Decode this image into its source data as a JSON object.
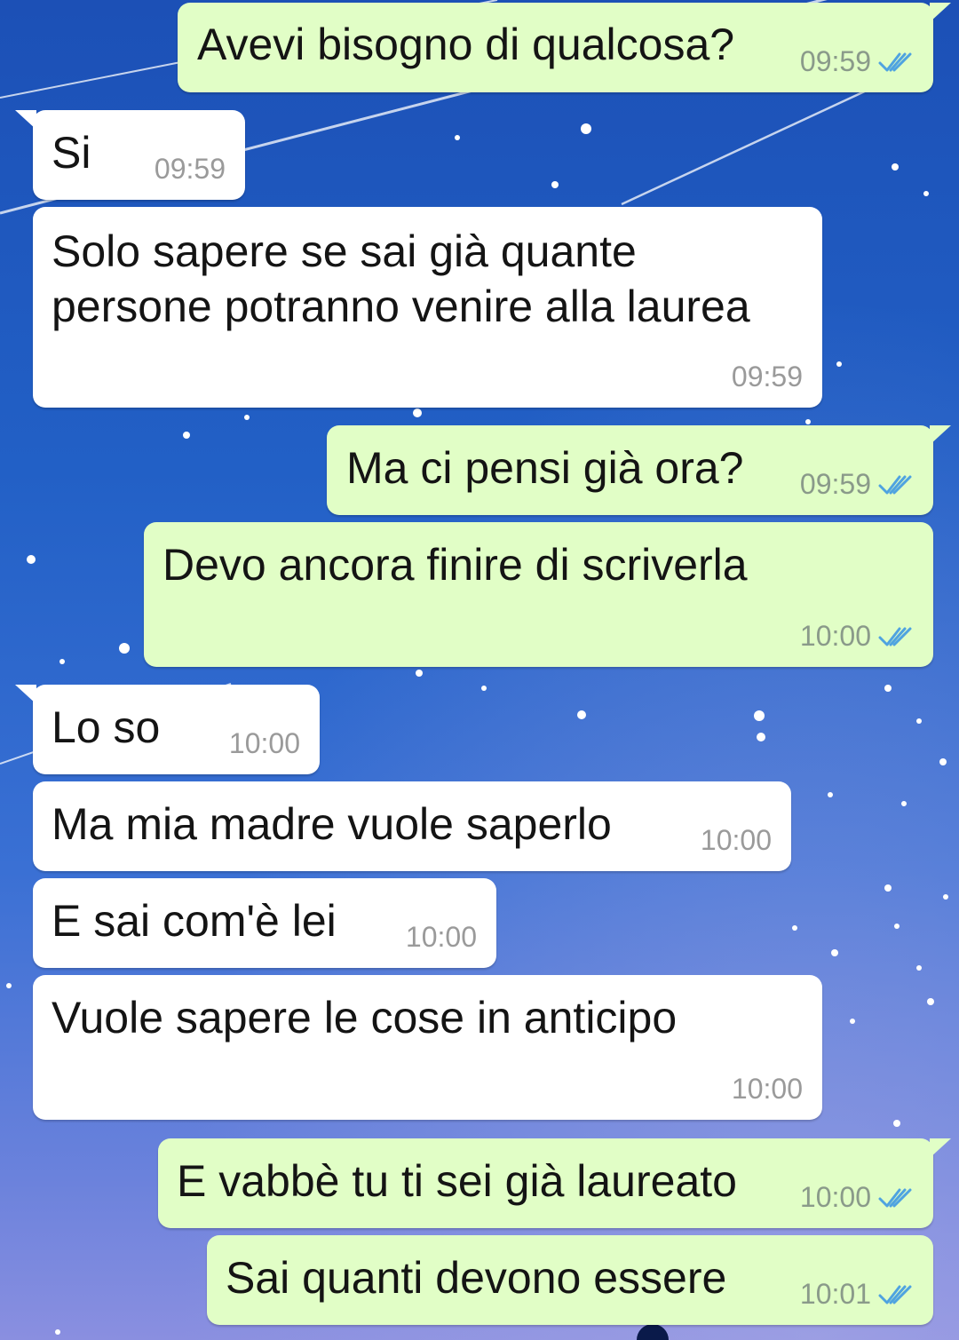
{
  "messages": [
    {
      "text": "Avevi bisogno di qualcosa?",
      "time": "09:59",
      "dir": "out"
    },
    {
      "text": "Si",
      "time": "09:59",
      "dir": "in"
    },
    {
      "text_line1": "Solo sapere se sai già quante",
      "text_line2": "persone potranno venire alla laurea",
      "time": "09:59",
      "dir": "in"
    },
    {
      "text": "Ma ci pensi già ora?",
      "time": "09:59",
      "dir": "out"
    },
    {
      "text": "Devo ancora finire di scriverla",
      "time": "10:00",
      "dir": "out"
    },
    {
      "text": "Lo so",
      "time": "10:00",
      "dir": "in"
    },
    {
      "text": "Ma mia madre vuole saperlo",
      "time": "10:00",
      "dir": "in"
    },
    {
      "text": "E sai com'è lei",
      "time": "10:00",
      "dir": "in"
    },
    {
      "text": "Vuole sapere le cose in anticipo",
      "time": "10:00",
      "dir": "in"
    },
    {
      "text": "E vabbè tu ti sei già laureato",
      "time": "10:00",
      "dir": "out"
    },
    {
      "text": "Sai quanti devono essere",
      "time": "10:01",
      "dir": "out"
    }
  ],
  "colors": {
    "outgoing_bubble": "#e1fec6",
    "incoming_bubble": "#ffffff",
    "read_ticks": "#4fa3e0"
  },
  "icons": {
    "read_receipt": "double-check-icon"
  }
}
